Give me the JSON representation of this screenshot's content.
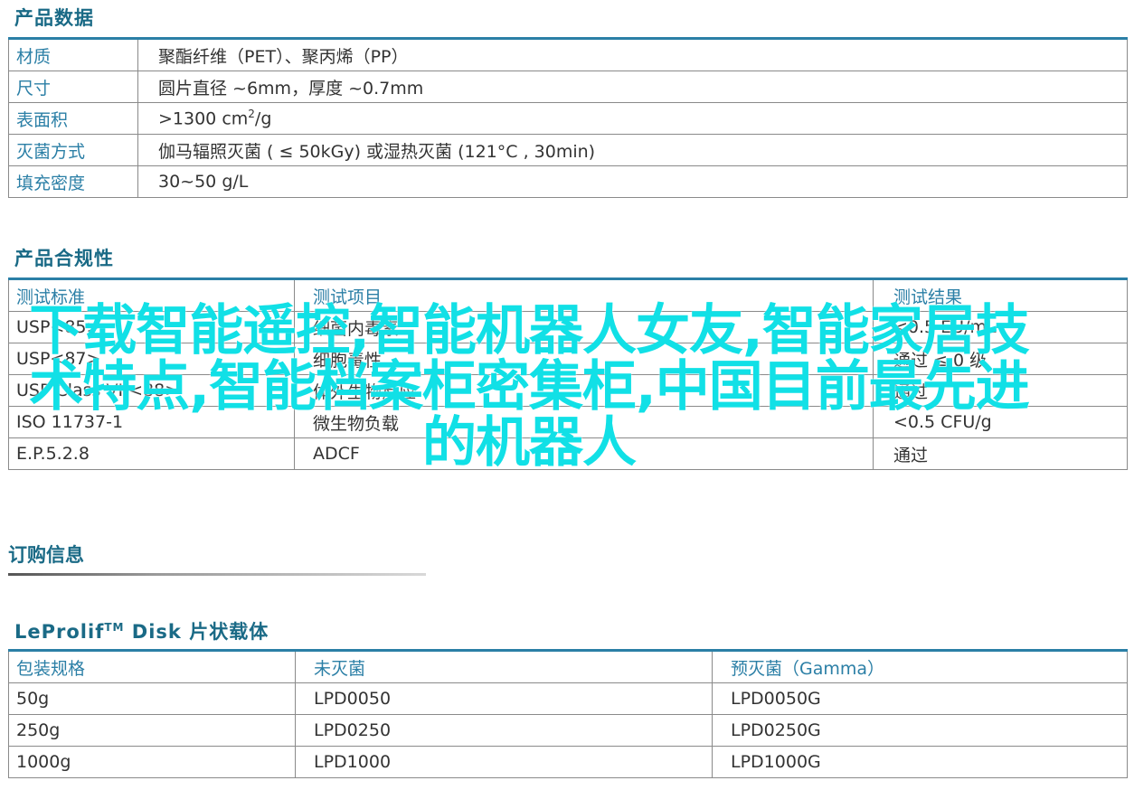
{
  "product_data": {
    "title": "产品数据",
    "rows": [
      {
        "label": "材质",
        "value": "聚酯纤维（PET）、聚丙烯（PP）"
      },
      {
        "label": "尺寸",
        "value": "圆片直径 ~6mm，厚度 ~0.7mm"
      },
      {
        "label": "表面积",
        "value_pre": ">1300 cm",
        "value_sup": "2",
        "value_post": "/g"
      },
      {
        "label": "灭菌方式",
        "value": "伽马辐照灭菌 ( ≤ 50kGy) 或湿热灭菌 (121°C , 30min)"
      },
      {
        "label": "填充密度",
        "value": "30~50 g/L"
      }
    ]
  },
  "compliance": {
    "title": "产品合规性",
    "headers": [
      "测试标准",
      "测试项目",
      "测试结果"
    ],
    "rows": [
      [
        "USP<85>",
        "细菌内毒素",
        "<0.5 EU/mL"
      ],
      [
        "USP<87>",
        "细胞毒性",
        "通过 ≤ 0 级"
      ],
      [
        "USP Class VI <88>",
        "体外生物反应",
        "通过"
      ],
      [
        "ISO 11737-1",
        "微生物负载",
        "<0.5 CFU/g"
      ],
      [
        "E.P.5.2.8",
        "ADCF",
        "通过"
      ]
    ]
  },
  "overlay_text": "下载智能遥控,智能机器人女友,智能家居技术特点,智能档案柜密集柜,中国目前最先进的机器人",
  "order": {
    "title": "订购信息",
    "product_pre": "LeProlif",
    "product_sup": "TM",
    "product_post": " Disk 片状载体",
    "headers": [
      "包装规格",
      "未灭菌",
      "预灭菌（Gamma）"
    ],
    "rows": [
      [
        "50g",
        "LPD0050",
        "LPD0050G"
      ],
      [
        "250g",
        "LPD0250",
        "LPD0250G"
      ],
      [
        "1000g",
        "LPD1000",
        "LPD1000G"
      ]
    ]
  }
}
